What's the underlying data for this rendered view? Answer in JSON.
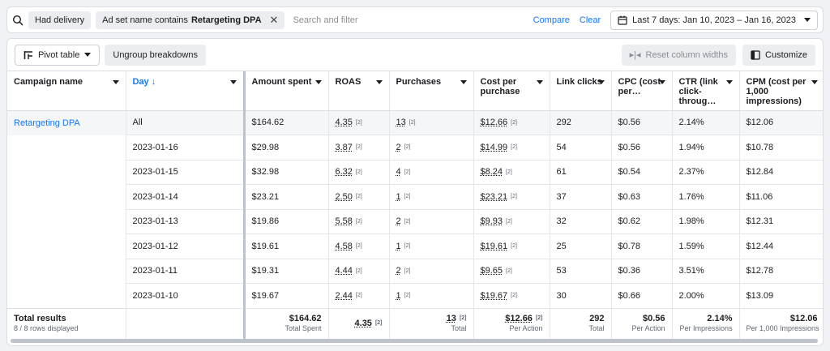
{
  "filters": {
    "chips": [
      {
        "label": "Had delivery",
        "bold": "",
        "removable": false
      },
      {
        "label": "Ad set name contains",
        "bold": "Retargeting DPA",
        "removable": true
      }
    ],
    "search_placeholder": "Search and filter",
    "compare_label": "Compare",
    "clear_label": "Clear",
    "date_range": "Last 7 days: Jan 10, 2023 – Jan 16, 2023"
  },
  "toolbar": {
    "pivot_label": "Pivot table",
    "ungroup_label": "Ungroup breakdowns",
    "reset_label": "Reset column widths",
    "customize_label": "Customize"
  },
  "columns": [
    {
      "label": "Campaign name"
    },
    {
      "label": "Day ↓"
    },
    {
      "label": "Amount spent"
    },
    {
      "label": "ROAS"
    },
    {
      "label": "Purchases"
    },
    {
      "label": "Cost per purchase"
    },
    {
      "label": "Link clicks"
    },
    {
      "label": "CPC (cost per…"
    },
    {
      "label": "CTR (link click-throug…"
    },
    {
      "label": "CPM (cost per 1,000 impressions)"
    }
  ],
  "campaign": "Retargeting DPA",
  "rows": [
    {
      "day": "All",
      "spent": "$164.62",
      "roas": "4.35",
      "purchases": "13",
      "cpp": "$12.66",
      "clicks": "292",
      "cpc": "$0.56",
      "ctr": "2.14%",
      "cpm": "$12.06"
    },
    {
      "day": "2023-01-16",
      "spent": "$29.98",
      "roas": "3.87",
      "purchases": "2",
      "cpp": "$14.99",
      "clicks": "54",
      "cpc": "$0.56",
      "ctr": "1.94%",
      "cpm": "$10.78"
    },
    {
      "day": "2023-01-15",
      "spent": "$32.98",
      "roas": "6.32",
      "purchases": "4",
      "cpp": "$8.24",
      "clicks": "61",
      "cpc": "$0.54",
      "ctr": "2.37%",
      "cpm": "$12.84"
    },
    {
      "day": "2023-01-14",
      "spent": "$23.21",
      "roas": "2.50",
      "purchases": "1",
      "cpp": "$23.21",
      "clicks": "37",
      "cpc": "$0.63",
      "ctr": "1.76%",
      "cpm": "$11.06"
    },
    {
      "day": "2023-01-13",
      "spent": "$19.86",
      "roas": "5.58",
      "purchases": "2",
      "cpp": "$9.93",
      "clicks": "32",
      "cpc": "$0.62",
      "ctr": "1.98%",
      "cpm": "$12.31"
    },
    {
      "day": "2023-01-12",
      "spent": "$19.61",
      "roas": "4.58",
      "purchases": "1",
      "cpp": "$19.61",
      "clicks": "25",
      "cpc": "$0.78",
      "ctr": "1.59%",
      "cpm": "$12.44"
    },
    {
      "day": "2023-01-11",
      "spent": "$19.31",
      "roas": "4.44",
      "purchases": "2",
      "cpp": "$9.65",
      "clicks": "53",
      "cpc": "$0.36",
      "ctr": "3.51%",
      "cpm": "$12.78"
    },
    {
      "day": "2023-01-10",
      "spent": "$19.67",
      "roas": "2.44",
      "purchases": "1",
      "cpp": "$19.67",
      "clicks": "30",
      "cpc": "$0.66",
      "ctr": "2.00%",
      "cpm": "$13.09"
    }
  ],
  "sup_mark": "[2]",
  "totals": {
    "label": "Total results",
    "sublabel": "8 / 8 rows displayed",
    "spent": "$164.62",
    "spent_sub": "Total Spent",
    "roas": "4.35",
    "purchases": "13",
    "purchases_sub": "Total",
    "cpp": "$12.66",
    "cpp_sub": "Per Action",
    "clicks": "292",
    "clicks_sub": "Total",
    "cpc": "$0.56",
    "cpc_sub": "Per Action",
    "ctr": "2.14%",
    "ctr_sub": "Per Impressions",
    "cpm": "$12.06",
    "cpm_sub": "Per 1,000 Impressions"
  },
  "colors": {
    "link": "#1877f2",
    "border": "#dadde1"
  }
}
